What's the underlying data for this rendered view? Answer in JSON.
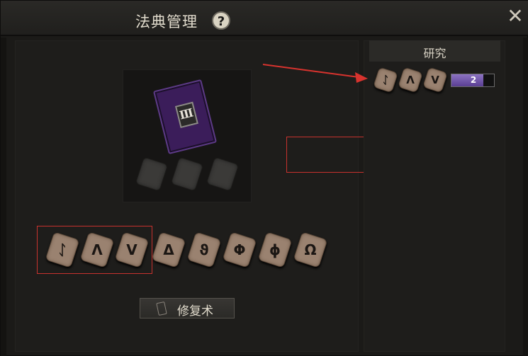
{
  "window": {
    "title": "法典管理",
    "help_symbol": "?",
    "close_symbol": "✕"
  },
  "book": {
    "tier": "Ⅲ",
    "color": "#3b1d5a",
    "empty_slots": 3
  },
  "runes": {
    "owned": [
      {
        "icon": "rune-zigzag-icon",
        "glyph": "ᛇ"
      },
      {
        "icon": "rune-lambda-icon",
        "glyph": "Λ"
      },
      {
        "icon": "rune-v-icon",
        "glyph": "V"
      },
      {
        "icon": "rune-triangle-icon",
        "glyph": "Δ"
      },
      {
        "icon": "rune-loop-triangle-icon",
        "glyph": "ϑ"
      },
      {
        "icon": "rune-circle-cross-icon",
        "glyph": "Φ"
      },
      {
        "icon": "rune-swirl-icon",
        "glyph": "ɸ"
      },
      {
        "icon": "rune-omega-icon",
        "glyph": "Ω"
      }
    ]
  },
  "action": {
    "label": "修复术",
    "icon": "scroll-icon"
  },
  "research": {
    "title": "研究",
    "recipe": [
      {
        "icon": "rune-zigzag-icon",
        "glyph": "ᛇ"
      },
      {
        "icon": "rune-lambda-icon",
        "glyph": "Λ"
      },
      {
        "icon": "rune-v-icon",
        "glyph": "V"
      }
    ],
    "level": "2",
    "level_fill_fraction": 0.75,
    "level_color": "#6f55a8"
  },
  "annotation_color": "#c8322e"
}
